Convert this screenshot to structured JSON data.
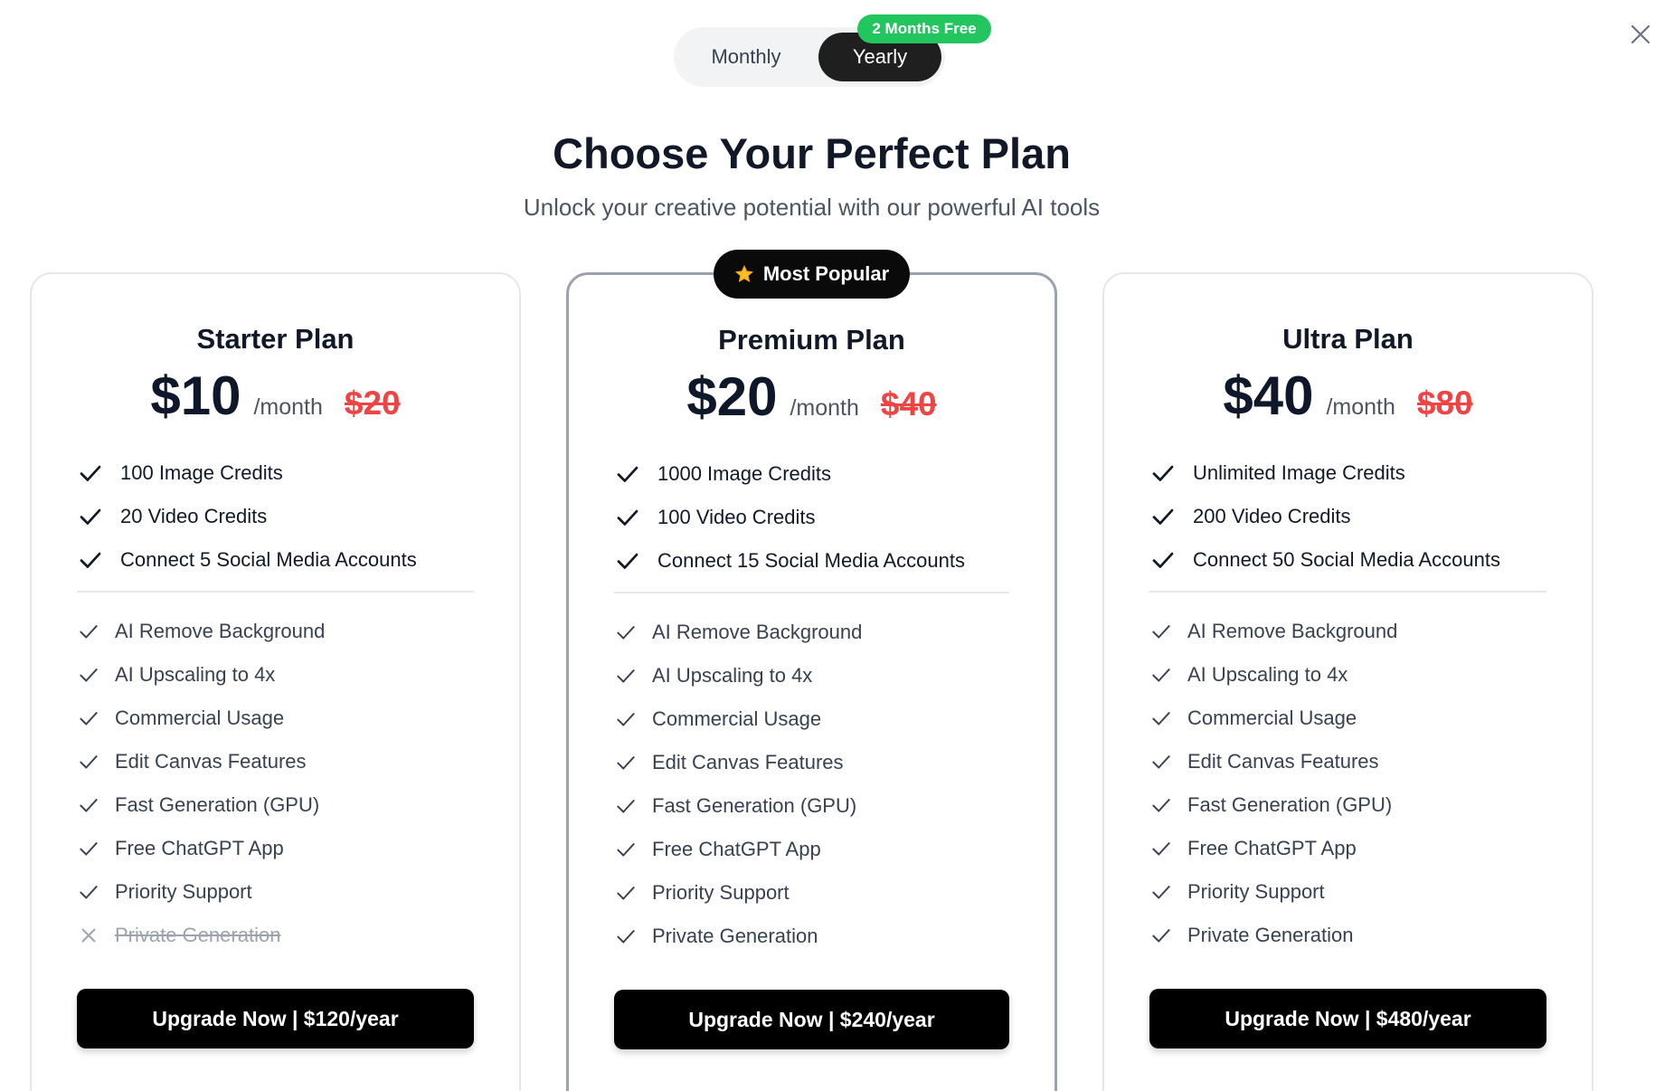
{
  "billing_toggle": {
    "monthly_label": "Monthly",
    "yearly_label": "Yearly",
    "selected": "Yearly",
    "promo_badge": "2 Months Free"
  },
  "header": {
    "title": "Choose Your Perfect Plan",
    "subtitle": "Unlock your creative potential with our powerful AI tools"
  },
  "popular_badge": {
    "label": "Most Popular",
    "icon": "star-icon"
  },
  "colors": {
    "accent_green": "#22c55e",
    "strike_red": "#ef4444",
    "button_black": "#000000"
  },
  "plans": [
    {
      "name": "Starter Plan",
      "price": "$10",
      "period": "/month",
      "old_price": "$20",
      "credits": [
        "100 Image Credits",
        "20 Video Credits",
        "Connect 5 Social Media Accounts"
      ],
      "features": [
        {
          "label": "AI Remove Background",
          "included": true
        },
        {
          "label": "AI Upscaling to 4x",
          "included": true
        },
        {
          "label": "Commercial Usage",
          "included": true
        },
        {
          "label": "Edit Canvas Features",
          "included": true
        },
        {
          "label": "Fast Generation (GPU)",
          "included": true
        },
        {
          "label": "Free ChatGPT App",
          "included": true
        },
        {
          "label": "Priority Support",
          "included": true
        },
        {
          "label": "Private Generation",
          "included": false
        }
      ],
      "cta": "Upgrade Now | $120/year"
    },
    {
      "name": "Premium Plan",
      "price": "$20",
      "period": "/month",
      "old_price": "$40",
      "credits": [
        "1000 Image Credits",
        "100 Video Credits",
        "Connect 15 Social Media Accounts"
      ],
      "features": [
        {
          "label": "AI Remove Background",
          "included": true
        },
        {
          "label": "AI Upscaling to 4x",
          "included": true
        },
        {
          "label": "Commercial Usage",
          "included": true
        },
        {
          "label": "Edit Canvas Features",
          "included": true
        },
        {
          "label": "Fast Generation (GPU)",
          "included": true
        },
        {
          "label": "Free ChatGPT App",
          "included": true
        },
        {
          "label": "Priority Support",
          "included": true
        },
        {
          "label": "Private Generation",
          "included": true
        }
      ],
      "cta": "Upgrade Now | $240/year"
    },
    {
      "name": "Ultra Plan",
      "price": "$40",
      "period": "/month",
      "old_price": "$80",
      "credits": [
        "Unlimited Image Credits",
        "200 Video Credits",
        "Connect 50 Social Media Accounts"
      ],
      "features": [
        {
          "label": "AI Remove Background",
          "included": true
        },
        {
          "label": "AI Upscaling to 4x",
          "included": true
        },
        {
          "label": "Commercial Usage",
          "included": true
        },
        {
          "label": "Edit Canvas Features",
          "included": true
        },
        {
          "label": "Fast Generation (GPU)",
          "included": true
        },
        {
          "label": "Free ChatGPT App",
          "included": true
        },
        {
          "label": "Priority Support",
          "included": true
        },
        {
          "label": "Private Generation",
          "included": true
        }
      ],
      "cta": "Upgrade Now | $480/year"
    }
  ]
}
